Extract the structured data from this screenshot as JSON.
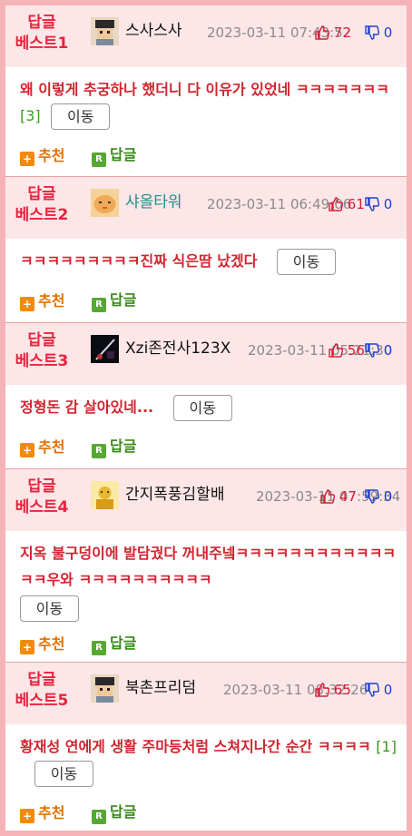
{
  "labels": {
    "move_button": "이동",
    "recommend": "추천",
    "reply": "답글",
    "plus_glyph": "+",
    "reply_glyph": "R"
  },
  "posts": [
    {
      "label_line1": "답글",
      "label_line2": "베스트1",
      "nickname": "스사스사",
      "date": "2023-03-11 07:43:52",
      "up": "72",
      "down": "0",
      "text": "왜 이렇게 추궁하나 했더니 다 이유가 있었네 ㅋㅋㅋㅋㅋㅋㅋ",
      "count": "[3]"
    },
    {
      "label_line1": "답글",
      "label_line2": "베스트2",
      "nickname": "샤올타워",
      "date": "2023-03-11 06:49:06",
      "up": "61",
      "down": "0",
      "text": "ㅋㅋㅋㅋㅋㅋㅋㅋㅋ진짜 식은땀 났겠다",
      "count": ""
    },
    {
      "label_line1": "답글",
      "label_line2": "베스트3",
      "nickname": "Xzi존전사123X",
      "date": "2023-03-11 05:21:30",
      "up": "56",
      "down": "0",
      "text": "정형돈 감 살아있네...",
      "count": ""
    },
    {
      "label_line1": "답글",
      "label_line2": "베스트4",
      "nickname": "간지폭풍김할배",
      "date": "2023-03-11 07:59:34",
      "up": "47",
      "down": "0",
      "text": "지옥 불구덩이에 발담궜다 꺼내주넼ㅋㅋㅋㅋㅋㅋㅋㅋㅋㅋㅋㅋㅋㅋ우와 ㅋㅋㅋㅋㅋㅋㅋㅋㅋㅋ",
      "count": ""
    },
    {
      "label_line1": "답글",
      "label_line2": "베스트5",
      "nickname": "북촌프리덤",
      "date": "2023-03-11 08:32:26",
      "up": "65",
      "down": "0",
      "text": "황재성 연에게 생활 주마등처럼 스쳐지나간 순간 ㅋㅋㅋㅋ",
      "count": "[1]"
    }
  ],
  "colors": {
    "frame": "#f6b3b7",
    "header_bg": "#fde6e7",
    "label": "#e8243e",
    "comment_text": "#d1242f",
    "recommend": "#e07000",
    "reply": "#3a8a1a",
    "up_vote": "#d5203a",
    "down_vote": "#1e3fcf",
    "nickname_highlight": "#1f8f8a"
  },
  "icons": {
    "up": "thumbs-up-icon",
    "down": "thumbs-down-icon",
    "recommend": "plus-square-icon",
    "reply": "reply-r-icon"
  }
}
